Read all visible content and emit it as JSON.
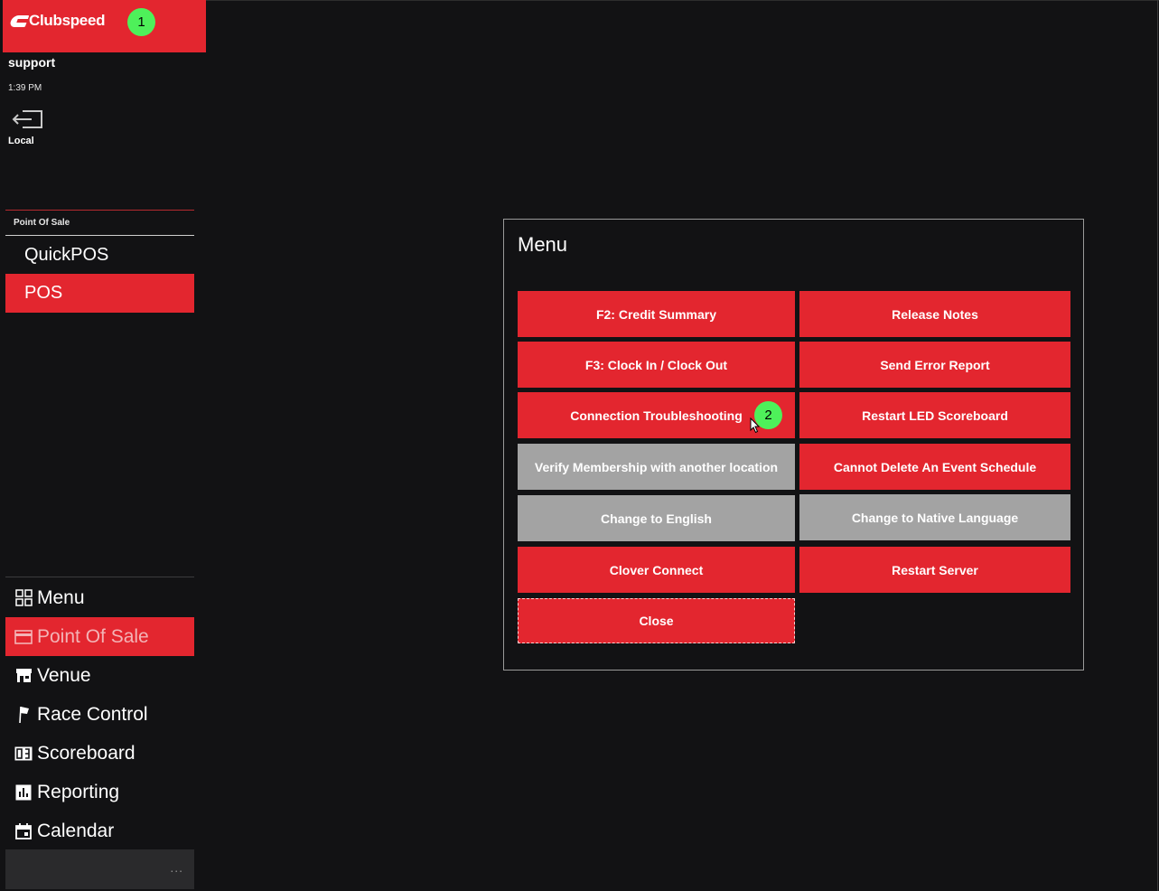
{
  "app": {
    "brand": "Clubspeed",
    "brand_color": "#e3262f"
  },
  "session": {
    "user": "support",
    "time": "1:39 PM",
    "location": "Local"
  },
  "annotations": {
    "badge_1": "1",
    "badge_2": "2",
    "badge_color": "#4ef05a"
  },
  "pos_section": {
    "label": "Point Of Sale",
    "items": [
      {
        "label": "QuickPOS",
        "active": false
      },
      {
        "label": "POS",
        "active": true
      }
    ]
  },
  "nav": {
    "items": [
      {
        "label": "Menu",
        "icon": "grid-icon",
        "active": false
      },
      {
        "label": "Point Of Sale",
        "icon": "card-icon",
        "active": true
      },
      {
        "label": "Venue",
        "icon": "store-icon",
        "active": false
      },
      {
        "label": "Race Control",
        "icon": "flag-icon",
        "active": false
      },
      {
        "label": "Scoreboard",
        "icon": "scoreboard-icon",
        "active": false
      },
      {
        "label": "Reporting",
        "icon": "chart-icon",
        "active": false
      },
      {
        "label": "Calendar",
        "icon": "calendar-icon",
        "active": false
      }
    ],
    "more": "..."
  },
  "dialog": {
    "title": "Menu",
    "buttons": {
      "credit_summary": "F2: Credit Summary",
      "release_notes": "Release Notes",
      "clock_in_out": "F3: Clock In / Clock Out",
      "send_error_report": "Send Error Report",
      "connection_troubleshooting": "Connection Troubleshooting",
      "restart_led_scoreboard": "Restart LED Scoreboard",
      "verify_membership": "Verify Membership with another location",
      "cannot_delete_event_schedule": "Cannot Delete An Event Schedule",
      "change_to_english": "Change to English",
      "change_to_native_language": "Change to Native Language",
      "clover_connect": "Clover Connect",
      "restart_server": "Restart Server",
      "close": "Close"
    },
    "disabled_color": "#a3a3a3"
  }
}
